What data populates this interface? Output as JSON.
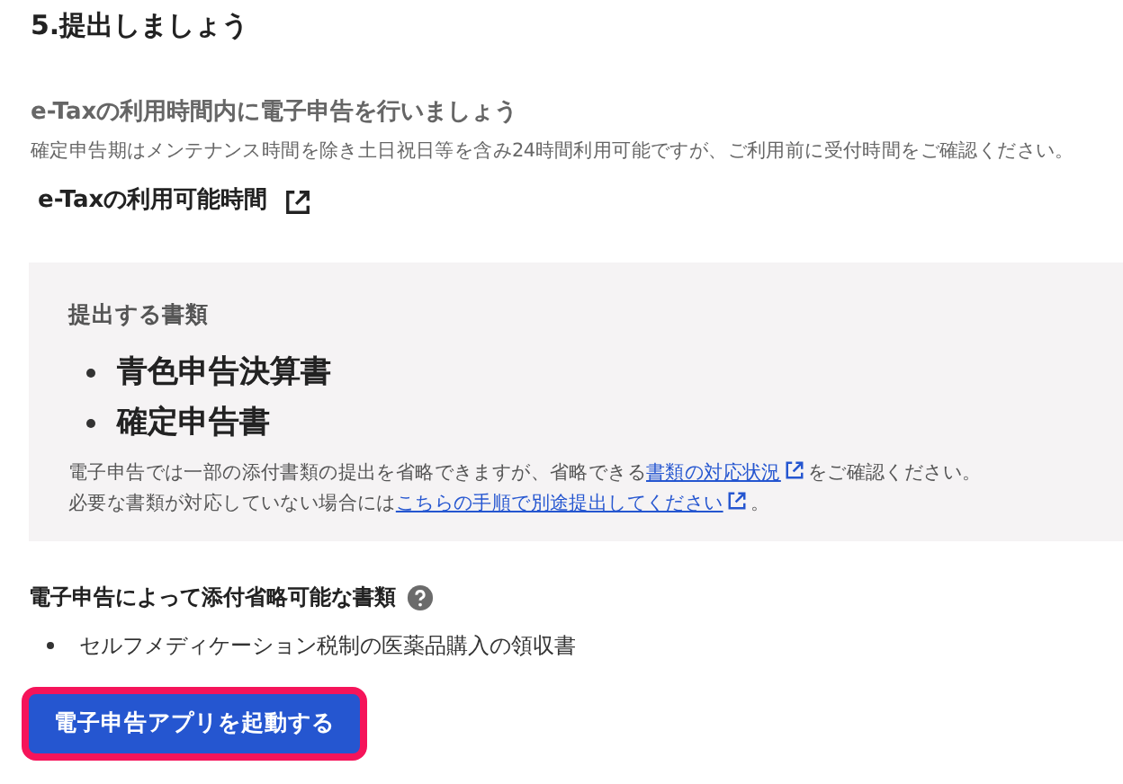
{
  "heading": "5.提出しましょう",
  "etax": {
    "title": "e-Taxの利用時間内に電子申告を行いましょう",
    "description": "確定申告期はメンテナンス時間を除き土日祝日等を含み24時間利用可能ですが、ご利用前に受付時間をご確認ください。",
    "link": "e-Taxの利用可能時間"
  },
  "documents": {
    "title": "提出する書類",
    "items": [
      "青色申告決算書",
      "確定申告書"
    ],
    "notes": [
      [
        {
          "kind": "text",
          "text": "電子申告では一部の添付書類の提出を省略できますが、省略できる"
        },
        {
          "kind": "link",
          "text": "書類の対応状況"
        },
        {
          "kind": "text",
          "text": "をご確認ください。"
        }
      ],
      [
        {
          "kind": "text",
          "text": "必要な書類が対応していない場合には"
        },
        {
          "kind": "link",
          "text": "こちらの手順で別途提出してください"
        },
        {
          "kind": "text",
          "text": "。"
        }
      ]
    ]
  },
  "omittable": {
    "title": "電子申告によって添付省略可能な書類",
    "items": [
      "セルフメディケーション税制の医薬品購入の領収書"
    ]
  },
  "button": {
    "label": "電子申告アプリを起動する",
    "focused": true
  }
}
